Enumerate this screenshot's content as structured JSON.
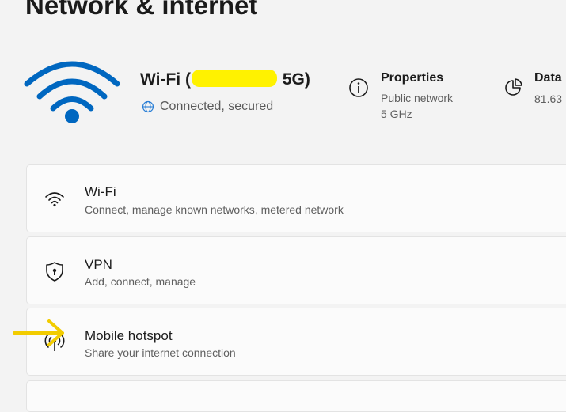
{
  "page": {
    "title": "Network & internet"
  },
  "connection": {
    "name_prefix": "Wi-Fi (",
    "name_suffix": "5G)",
    "status": "Connected, secured",
    "status_icon": "globe-icon",
    "hero_icon": "wifi-icon"
  },
  "properties": {
    "title": "Properties",
    "line1": "Public network",
    "line2": "5 GHz",
    "icon": "info-icon"
  },
  "data_usage": {
    "title": "Data",
    "line1": "81.63",
    "icon": "pie-chart-icon"
  },
  "cards": [
    {
      "title": "Wi-Fi",
      "subtitle": "Connect, manage known networks, metered network",
      "icon": "wifi-icon"
    },
    {
      "title": "VPN",
      "subtitle": "Add, connect, manage",
      "icon": "shield-icon"
    },
    {
      "title": "Mobile hotspot",
      "subtitle": "Share your internet connection",
      "icon": "hotspot-icon"
    }
  ],
  "colors": {
    "accent": "#0067c0",
    "highlight": "#fff200",
    "arrow": "#f2cc00"
  }
}
